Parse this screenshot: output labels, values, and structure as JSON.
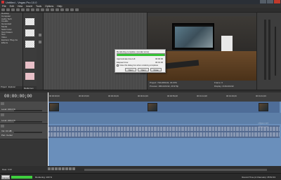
{
  "window": {
    "title": "Untitled - Vegas Pro 10.0"
  },
  "menu": [
    "File",
    "Edit",
    "View",
    "Insert",
    "Tools",
    "Options",
    "Help"
  ],
  "explorer": {
    "items": [
      "Desktop",
      "Computer",
      "Audio Tech",
      "Credits",
      "Generated",
      "Media",
      "Solid Color",
      "Test Pattern",
      "Text",
      "Video",
      "Explorer Plug-Ins",
      "Effects"
    ],
    "tabs": [
      "Project",
      "Explorer",
      "Media Gen"
    ]
  },
  "preview": {
    "info_left": "Project: 720x480x32, 29.970i",
    "info_left2": "Preview: 180x120x32, 29.970p",
    "info_right": "Frame: 0",
    "info_right2": "Display: 210x140x32"
  },
  "timeline": {
    "timecode": "00:00:00;00",
    "ruler": [
      "00:00:00;00",
      "00:00:15;00",
      "00:00:29;29",
      "00:00:44;29",
      "00:00:59;28",
      "00:01:14;28",
      "00:01:29;29",
      "00:01:44;29"
    ],
    "tracks": [
      {
        "num": "1",
        "label": "Level: 100.0 %"
      },
      {
        "num": "2",
        "label": "Level: 100.0 %"
      },
      {
        "num": "3",
        "label": "Vol: 0.0 dB",
        "label2": "Pan: Center"
      }
    ],
    "watermark_line1": "dtpa.net",
    "watermark_line2": "dtpa.net",
    "rate": "Rate: 0.00"
  },
  "status": {
    "cancel_label": "Cancel",
    "progress_fraction": 1.0,
    "text": "Rendering: 100 %",
    "right": "Record Time (2 channels): 35:52:43"
  },
  "dialog": {
    "title": "Rendering complete: (render.wmv)",
    "progress_fraction": 1.0,
    "rows": [
      {
        "label": "Approximate time left:",
        "value": "00:00:00"
      },
      {
        "label": "Elapsed time:",
        "value": "00:01:00"
      }
    ],
    "checkbox_label": "Close this dialog box when rendering completes",
    "buttons": [
      "Open",
      "Open Folder",
      "Close"
    ]
  },
  "colors": {
    "track_bg": "#6a8fbb",
    "progress": "#35c135"
  }
}
